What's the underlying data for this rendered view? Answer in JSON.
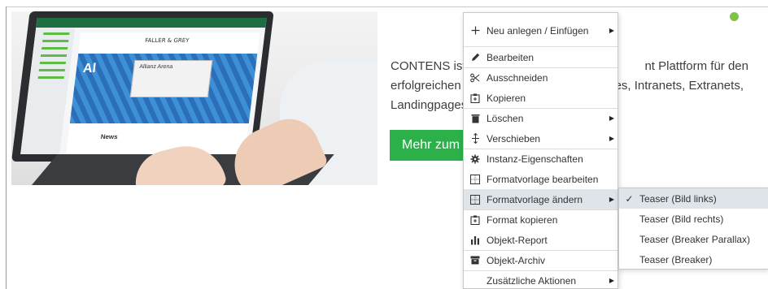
{
  "teaser": {
    "screen_logo": "FALLER & GREY",
    "screen_hero_title": "Allianz Arena",
    "screen_news": "News",
    "text": "CONTENS ist d… nt Plattform für den erfolgreichen B… sites, Intranets, Extranets, Landingpages …",
    "text_line1_left": "CONTENS ist d",
    "text_line1_right": "nt Plattform für den",
    "text_line2_left": "erfolgreichen B",
    "text_line2_right": "sites, Intranets, Extranets,",
    "text_line3_left": "Landingpages u",
    "cta_label": "Mehr zum C",
    "status_color": "#80c342",
    "cta_color": "#2bb04a"
  },
  "context_menu": {
    "items": [
      {
        "icon": "plus-icon",
        "label": "Neu anlegen / Einfügen",
        "submenu": true
      },
      {
        "icon": "pencil-icon",
        "label": "Bearbeiten",
        "submenu": false
      },
      {
        "icon": "scissors-icon",
        "label": "Ausschneiden",
        "submenu": false
      },
      {
        "icon": "copy-icon",
        "label": "Kopieren",
        "submenu": false
      },
      {
        "icon": "trash-icon",
        "label": "Löschen",
        "submenu": true
      },
      {
        "icon": "move-icon",
        "label": "Verschieben",
        "submenu": true
      },
      {
        "icon": "gear-icon",
        "label": "Instanz-Eigenschaften",
        "submenu": false
      },
      {
        "icon": "layout-icon",
        "label": "Formatvorlage bearbeiten",
        "submenu": false
      },
      {
        "icon": "layout-icon",
        "label": "Formatvorlage ändern",
        "submenu": true,
        "active": true
      },
      {
        "icon": "copy-icon",
        "label": "Format kopieren",
        "submenu": false
      },
      {
        "icon": "bar-chart-icon",
        "label": "Objekt-Report",
        "submenu": false
      },
      {
        "icon": "archive-icon",
        "label": "Objekt-Archiv",
        "submenu": false
      },
      {
        "icon": "",
        "label": "Zusätzliche Aktionen",
        "submenu": true
      }
    ]
  },
  "submenu": {
    "items": [
      {
        "label": "Teaser (Bild links)",
        "checked": true
      },
      {
        "label": "Teaser (Bild rechts)",
        "checked": false
      },
      {
        "label": "Teaser (Breaker Parallax)",
        "checked": false
      },
      {
        "label": "Teaser (Breaker)",
        "checked": false
      }
    ]
  }
}
